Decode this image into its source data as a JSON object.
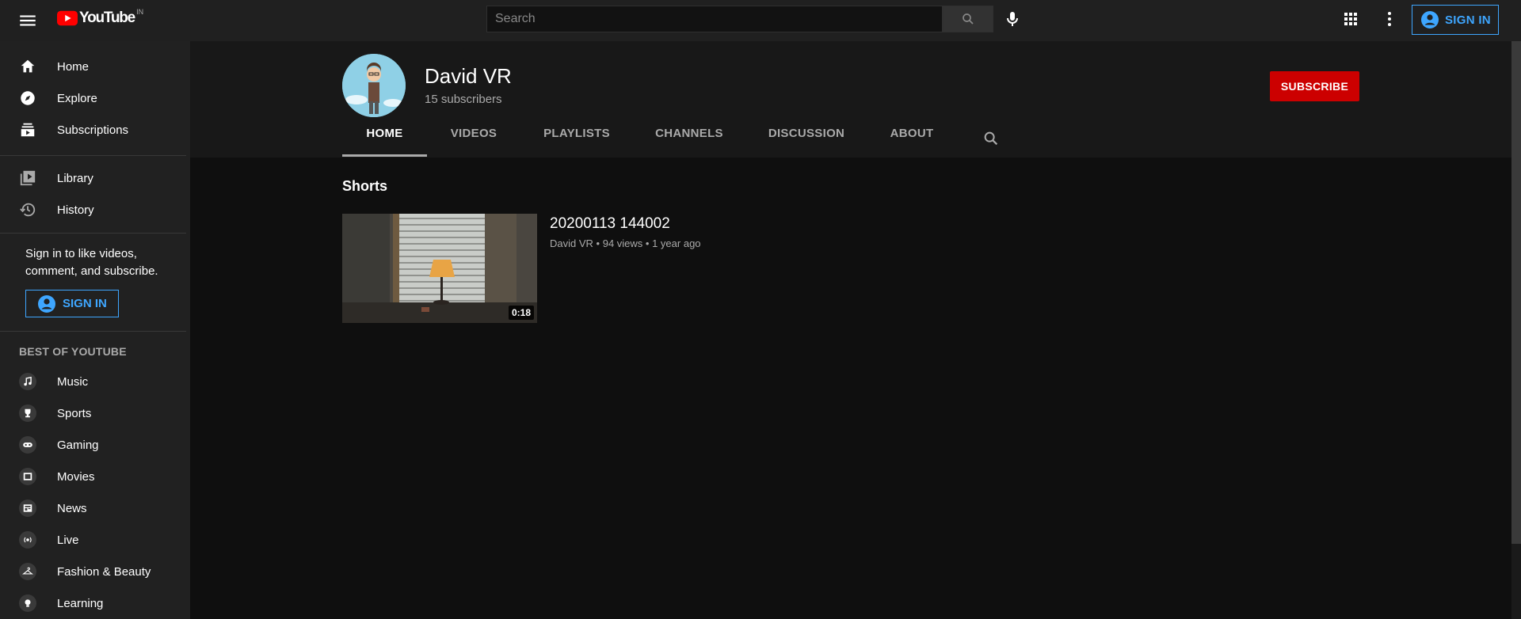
{
  "header": {
    "logo_text": "YouTube",
    "country_code": "IN",
    "search_placeholder": "Search",
    "sign_in_label": "SIGN IN"
  },
  "sidebar": {
    "primary": [
      {
        "label": "Home",
        "icon": "home-icon"
      },
      {
        "label": "Explore",
        "icon": "compass-icon"
      },
      {
        "label": "Subscriptions",
        "icon": "subscriptions-icon"
      }
    ],
    "secondary": [
      {
        "label": "Library",
        "icon": "library-icon"
      },
      {
        "label": "History",
        "icon": "history-icon"
      }
    ],
    "signin_note": "Sign in to like videos, comment, and subscribe.",
    "signin_label": "SIGN IN",
    "best_of_title": "BEST OF YOUTUBE",
    "best_of": [
      {
        "label": "Music",
        "icon": "music-icon"
      },
      {
        "label": "Sports",
        "icon": "trophy-icon"
      },
      {
        "label": "Gaming",
        "icon": "gaming-icon"
      },
      {
        "label": "Movies",
        "icon": "movies-icon"
      },
      {
        "label": "News",
        "icon": "news-icon"
      },
      {
        "label": "Live",
        "icon": "live-icon"
      },
      {
        "label": "Fashion & Beauty",
        "icon": "hanger-icon"
      },
      {
        "label": "Learning",
        "icon": "lightbulb-icon"
      }
    ]
  },
  "channel": {
    "name": "David VR",
    "subscribers": "15 subscribers",
    "subscribe_label": "SUBSCRIBE",
    "tabs": [
      "HOME",
      "VIDEOS",
      "PLAYLISTS",
      "CHANNELS",
      "DISCUSSION",
      "ABOUT"
    ],
    "active_tab": "HOME"
  },
  "content": {
    "shelf_title": "Shorts",
    "video": {
      "title": "20200113 144002",
      "channel": "David VR",
      "views": "94 views",
      "age": "1 year ago",
      "duration": "0:18"
    }
  },
  "colors": {
    "accent_blue": "#3ea6ff",
    "subscribe_red": "#cc0000",
    "background": "#0f0f0f",
    "sidebar": "#212121"
  }
}
